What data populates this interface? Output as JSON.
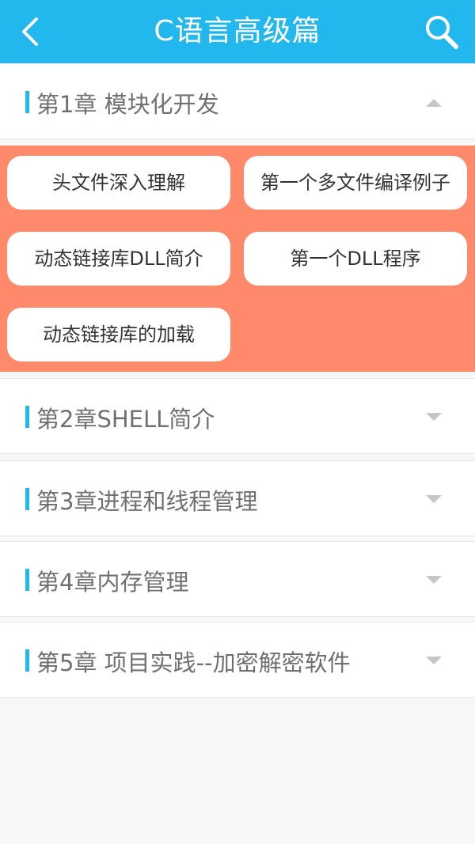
{
  "header": {
    "title": "C语言高级篇",
    "back_icon": "chevron-left-icon",
    "search_icon": "search-icon",
    "background_color": "#22b8ee"
  },
  "chapters": [
    {
      "label": "第1章 模块化开发",
      "expanded": true,
      "lessons": [
        "头文件深入理解",
        "第一个多文件编译例子",
        "动态链接库DLL简介",
        "第一个DLL程序",
        "动态链接库的加载"
      ]
    },
    {
      "label": "第2章SHELL简介",
      "expanded": false
    },
    {
      "label": "第3章进程和线程管理",
      "expanded": false
    },
    {
      "label": "第4章内存管理",
      "expanded": false
    },
    {
      "label": "第5章 项目实践--加密解密软件",
      "expanded": false
    }
  ],
  "colors": {
    "expanded_panel": "#ff8a6b",
    "accent": "#22b8ee",
    "chapter_text": "#707070"
  }
}
